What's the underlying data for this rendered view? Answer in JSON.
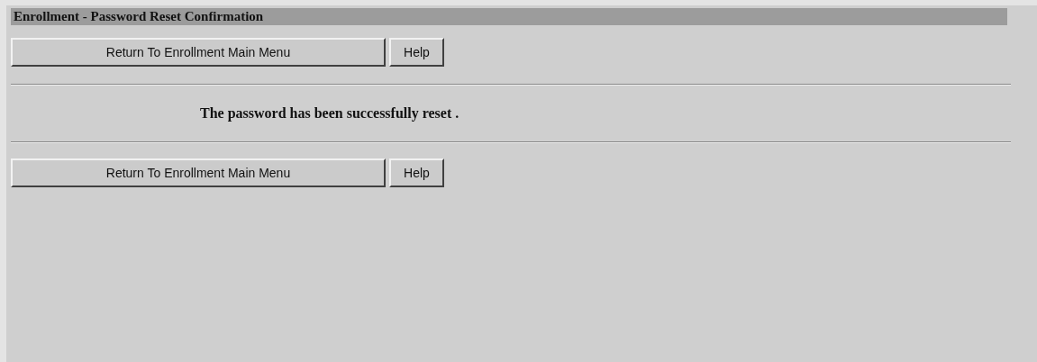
{
  "title": "Enrollment - Password Reset Confirmation",
  "top_buttons": [
    {
      "label": "Return To Enrollment Main Menu",
      "kind": "wide"
    },
    {
      "label": "Help",
      "kind": "small"
    }
  ],
  "message": "The password has been successfully reset .",
  "bottom_buttons": [
    {
      "label": "Return To Enrollment Main Menu",
      "kind": "wide"
    },
    {
      "label": "Help",
      "kind": "small"
    }
  ]
}
